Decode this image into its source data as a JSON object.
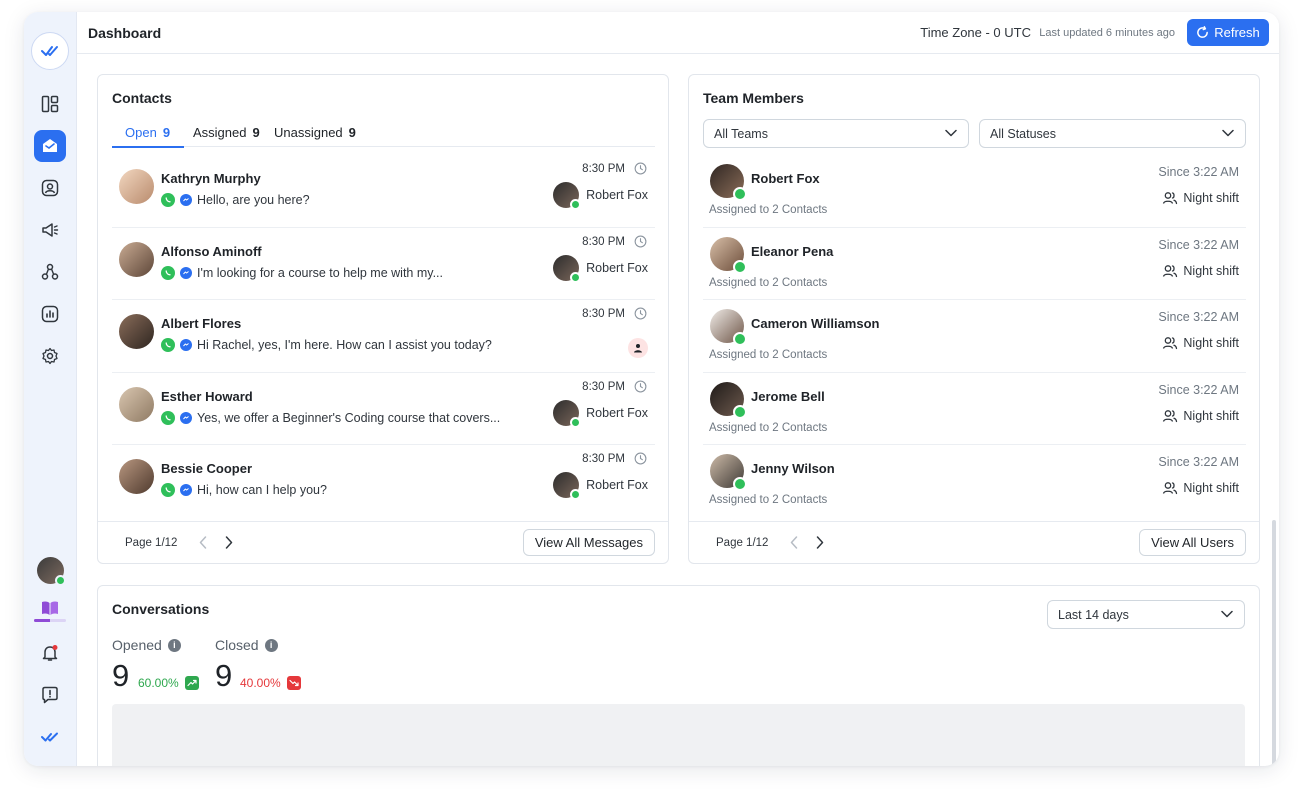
{
  "header": {
    "title": "Dashboard",
    "timezone": "Time Zone - 0 UTC",
    "last_updated": "Last updated 6 minutes ago",
    "refresh_label": "Refresh"
  },
  "sidebar": {
    "items": [
      {
        "name": "dashboard-icon"
      },
      {
        "name": "inbox-icon",
        "active": true
      },
      {
        "name": "contacts-icon"
      },
      {
        "name": "broadcast-icon"
      },
      {
        "name": "integrations-icon"
      },
      {
        "name": "reports-icon"
      },
      {
        "name": "settings-icon"
      }
    ],
    "bottom": [
      "guide-book-icon",
      "notifications-icon",
      "help-icon",
      "brand-icon"
    ],
    "guide_progress": 0.5
  },
  "contacts": {
    "title": "Contacts",
    "tabs": [
      {
        "label": "Open",
        "count": "9"
      },
      {
        "label": "Assigned",
        "count": "9"
      },
      {
        "label": "Unassigned",
        "count": "9"
      }
    ],
    "rows": [
      {
        "name": "Kathryn Murphy",
        "message": "Hello, are you here?",
        "time": "8:30 PM",
        "agent": "Robert Fox"
      },
      {
        "name": "Alfonso Aminoff",
        "message": "I'm looking for a course to help me with my...",
        "time": "8:30 PM",
        "agent": "Robert Fox"
      },
      {
        "name": "Albert Flores",
        "message": "Hi Rachel, yes, I'm here. How can I assist you today?",
        "time": "8:30 PM",
        "agent": ""
      },
      {
        "name": "Esther Howard",
        "message": "Yes, we offer a Beginner's Coding course that covers...",
        "time": "8:30 PM",
        "agent": "Robert Fox"
      },
      {
        "name": "Bessie Cooper",
        "message": "Hi, how can I help you?",
        "time": "8:30 PM",
        "agent": "Robert Fox"
      }
    ],
    "page": "Page 1/12",
    "view_all": "View All Messages"
  },
  "team": {
    "title": "Team Members",
    "team_filter": "All Teams",
    "status_filter": "All Statuses",
    "members": [
      {
        "name": "Robert Fox",
        "assigned": "Assigned to 2 Contacts",
        "since": "Since 3:22 AM",
        "shift": "Night shift"
      },
      {
        "name": "Eleanor Pena",
        "assigned": "Assigned to 2 Contacts",
        "since": "Since 3:22 AM",
        "shift": "Night shift"
      },
      {
        "name": "Cameron Williamson",
        "assigned": "Assigned to 2 Contacts",
        "since": "Since 3:22 AM",
        "shift": "Night shift"
      },
      {
        "name": "Jerome Bell",
        "assigned": "Assigned to 2 Contacts",
        "since": "Since 3:22 AM",
        "shift": "Night shift"
      },
      {
        "name": "Jenny Wilson",
        "assigned": "Assigned to 2 Contacts",
        "since": "Since 3:22 AM",
        "shift": "Night shift"
      }
    ],
    "page": "Page 1/12",
    "view_all": "View All Users"
  },
  "conversations": {
    "title": "Conversations",
    "range": "Last 14 days",
    "opened": {
      "label": "Opened",
      "value": "9",
      "pct": "60.00%"
    },
    "closed": {
      "label": "Closed",
      "value": "9",
      "pct": "40.00%"
    }
  },
  "colors": {
    "accent": "#2b6ff0",
    "online": "#2fbf5a",
    "positive": "#2fa84f",
    "negative": "#e5383b",
    "sidebar_bg": "#eef3fc"
  }
}
